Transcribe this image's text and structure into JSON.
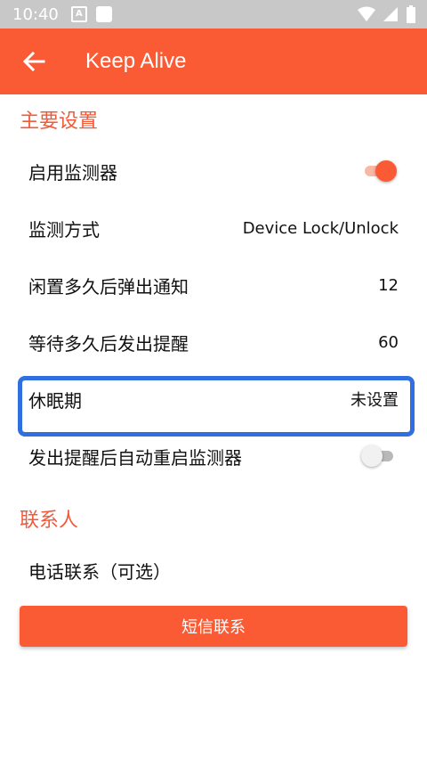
{
  "status_bar": {
    "time": "10:40",
    "a_icon_letter": "A"
  },
  "app_bar": {
    "title": "Keep Alive"
  },
  "sections": {
    "main_settings": "主要设置",
    "contacts": "联系人"
  },
  "settings": {
    "enable_monitor_label": "启用监测器",
    "enable_monitor_on": true,
    "monitor_method_label": "监测方式",
    "monitor_method_value": "Device Lock/Unlock",
    "idle_notify_label": "闲置多久后弹出通知",
    "idle_notify_value": "12",
    "wait_alert_label": "等待多久后发出提醒",
    "wait_alert_value": "60",
    "sleep_label": "休眠期",
    "sleep_value": "未设置",
    "restart_label": "发出提醒后自动重启监测器",
    "restart_on": false
  },
  "contacts": {
    "phone_label": "电话联系（可选）",
    "sms_button": "短信联系"
  },
  "colors": {
    "accent": "#fb5b34",
    "section_title": "#f05a3a",
    "highlight": "#2f6fe0"
  }
}
